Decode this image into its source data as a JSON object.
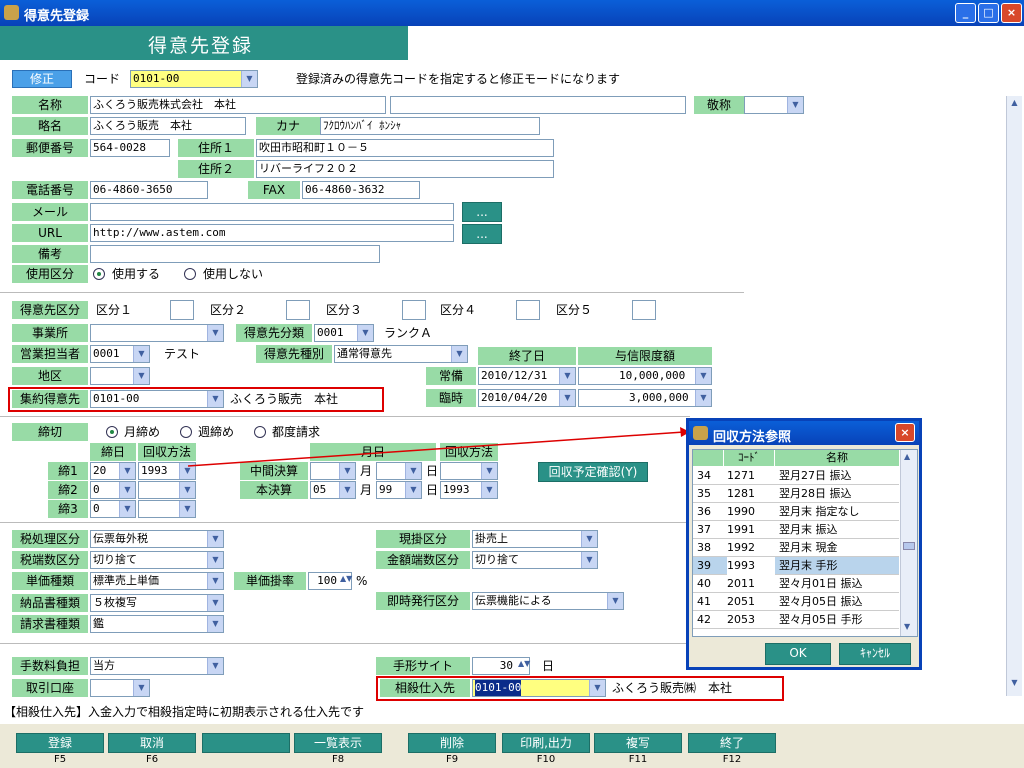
{
  "window": {
    "title": "得意先登録",
    "minimize": "_",
    "maximize": "□",
    "close": "×"
  },
  "header": {
    "title": "得意先登録"
  },
  "top": {
    "mode": "修正",
    "code_label": "コード",
    "code_value": "0101-00",
    "hint": "登録済みの得意先コードを指定すると修正モードになります"
  },
  "form": {
    "name_label": "名称",
    "name_value": "ふくろう販売株式会社　本社",
    "honorific_label": "敬称",
    "short_label": "略名",
    "short_value": "ふくろう販売　本社",
    "kana_label": "カナ",
    "kana_value": "ﾌｸﾛｳﾊﾝﾊﾞｲ ﾎﾝｼｬ",
    "zip_label": "郵便番号",
    "zip_value": "564-0028",
    "addr1_label": "住所１",
    "addr1_value": "吹田市昭和町１０－５",
    "addr2_label": "住所２",
    "addr2_value": "リバーライフ２０２",
    "tel_label": "電話番号",
    "tel_value": "06-4860-3650",
    "fax_label": "FAX",
    "fax_value": "06-4860-3632",
    "mail_label": "メール",
    "url_label": "URL",
    "url_value": "http://www.astem.com",
    "dots": "...",
    "note_label": "備考",
    "use_label": "使用区分",
    "use_on": "使用する",
    "use_off": "使用しない"
  },
  "cat": {
    "kbn_label": "得意先区分",
    "k1": "区分１",
    "k2": "区分２",
    "k3": "区分３",
    "k4": "区分４",
    "k5": "区分５",
    "office_label": "事業所",
    "class_label": "得意先分類",
    "class_value": "0001",
    "rank": "ランクＡ",
    "sales_label": "営業担当者",
    "sales_value": "0001",
    "sales_name": "テスト",
    "type_label": "得意先種別",
    "type_value": "通常得意先",
    "end_label": "終了日",
    "limit_label": "与信限度額",
    "area_label": "地区",
    "normal_label": "常備",
    "normal_date": "2010/12/31",
    "normal_amount": "10,000,000",
    "temp_label": "臨時",
    "temp_date": "2010/04/20",
    "temp_amount": "3,000,000",
    "group_label": "集約得意先",
    "group_value": "0101-00",
    "group_name": "ふくろう販売　本社"
  },
  "close": {
    "label": "締切",
    "m": "月締め",
    "w": "週締め",
    "e": "都度請求",
    "day_label": "締日",
    "method_label": "回収方法",
    "month_label": "月日",
    "method2_label": "回収方法",
    "c1": "締1",
    "c2": "締2",
    "c3": "締3",
    "c1_day": "20",
    "c1_method": "1993",
    "c2_day": "0",
    "c3_day": "0",
    "mid_label": "中間決算",
    "main_label": "本決算",
    "month": "月",
    "day": "日",
    "main_m": "05",
    "main_d": "99",
    "main_method": "1993",
    "confirm_btn": "回収予定確認(Y)"
  },
  "tax": {
    "tax_label": "税処理区分",
    "tax_value": "伝票毎外税",
    "round_label": "税端数区分",
    "round_value": "切り捨て",
    "price_label": "単価種類",
    "price_value": "標準売上単価",
    "rate_label": "単価掛率",
    "rate_value": "100",
    "pct": "%",
    "slip_label": "納品書種類",
    "slip_value": "５枚複写",
    "bill_label": "請求書種類",
    "bill_value": "鑑",
    "cash_label": "現掛区分",
    "cash_value": "掛売上",
    "amt_label": "金額端数区分",
    "amt_value": "切り捨て",
    "issue_label": "即時発行区分",
    "issue_value": "伝票機能による",
    "fee_label": "手数料負担",
    "fee_value": "当方",
    "bank_label": "取引口座",
    "bill_site_label": "手形サイト",
    "bill_site_value": "30",
    "day": "日",
    "offset_label": "相殺仕入先",
    "offset_value": "0101-00",
    "offset_name": "ふくろう販売㈱　本社"
  },
  "status": "【相殺仕入先】入金入力で相殺指定時に初期表示される仕入先です",
  "fbuttons": [
    {
      "label": "登録",
      "key": "F5"
    },
    {
      "label": "取消",
      "key": "F6"
    },
    {
      "label": "",
      "key": ""
    },
    {
      "label": "一覧表示",
      "key": "F8"
    },
    {
      "label": "削除",
      "key": "F9"
    },
    {
      "label": "印刷,出力",
      "key": "F10"
    },
    {
      "label": "複写",
      "key": "F11"
    },
    {
      "label": "終了",
      "key": "F12"
    }
  ],
  "dialog": {
    "title": "回収方法参照",
    "col_code": "ｺｰﾄﾞ",
    "col_name": "名称",
    "ok": "OK",
    "cancel": "ｷｬﾝｾﾙ",
    "rows": [
      {
        "no": "34",
        "code": "1271",
        "name": "翌月27日 振込"
      },
      {
        "no": "35",
        "code": "1281",
        "name": "翌月28日 振込"
      },
      {
        "no": "36",
        "code": "1990",
        "name": "翌月末 指定なし"
      },
      {
        "no": "37",
        "code": "1991",
        "name": "翌月末 振込"
      },
      {
        "no": "38",
        "code": "1992",
        "name": "翌月末 現金"
      },
      {
        "no": "39",
        "code": "1993",
        "name": "翌月末 手形"
      },
      {
        "no": "40",
        "code": "2011",
        "name": "翌々月01日 振込"
      },
      {
        "no": "41",
        "code": "2051",
        "name": "翌々月05日 振込"
      },
      {
        "no": "42",
        "code": "2053",
        "name": "翌々月05日 手形"
      }
    ]
  },
  "colors": {
    "title": "#0842b8",
    "header": "#2a9187",
    "label": "#98dba6",
    "highlight": "#ffff80",
    "alert": "#d00"
  }
}
